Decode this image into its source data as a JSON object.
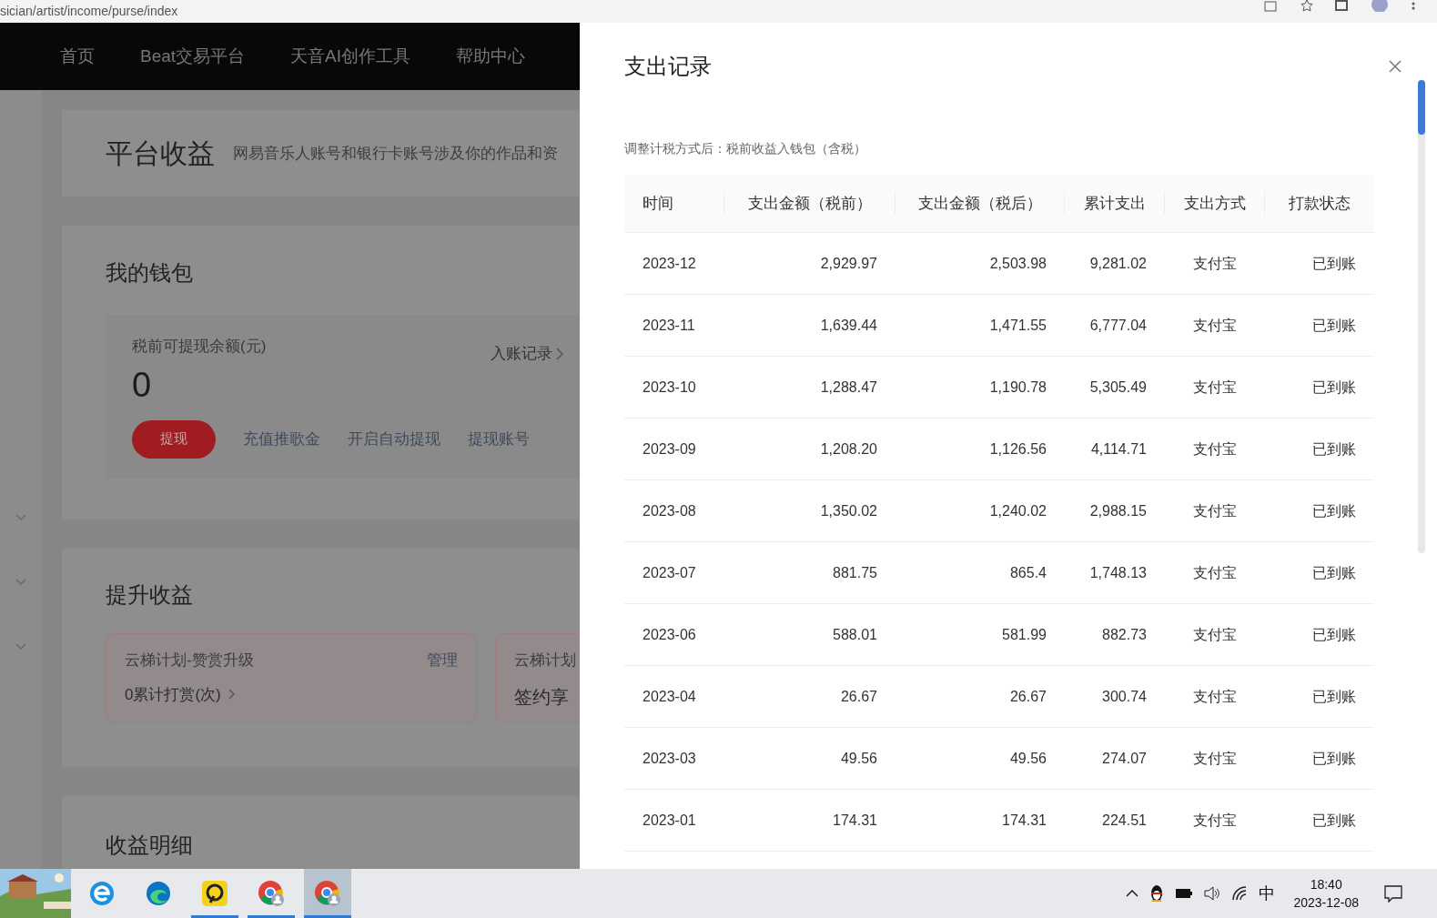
{
  "browser": {
    "url": "sician/artist/income/purse/index"
  },
  "nav": [
    {
      "label": "首页"
    },
    {
      "label": "Beat交易平台"
    },
    {
      "label": "天音AI创作工具"
    },
    {
      "label": "帮助中心"
    }
  ],
  "page": {
    "header": {
      "title": "平台收益",
      "description": "网易音乐人账号和银行卡账号涉及你的作品和资"
    },
    "wallet": {
      "title": "我的钱包",
      "balance_label": "税前可提现余额(元)",
      "balance": "0",
      "records_link": "入账记录",
      "withdraw_button": "提现",
      "links": [
        "充值推歌金",
        "开启自动提现",
        "提现账号"
      ]
    },
    "boost": {
      "title": "提升收益",
      "cards": [
        {
          "title": "云梯计划-赞赏升级",
          "action": "管理",
          "stat": "0累计打赏(次)"
        },
        {
          "title": "云梯计划",
          "stat": "签约享"
        }
      ]
    },
    "details": {
      "title": "收益明细"
    }
  },
  "drawer": {
    "title": "支出记录",
    "note": "调整计税方式后：税前收益入钱包（含税）",
    "columns": [
      "时间",
      "支出金额（税前）",
      "支出金额（税后）",
      "累计支出",
      "支出方式",
      "打款状态"
    ],
    "rows": [
      [
        "2023-12",
        "2,929.97",
        "2,503.98",
        "9,281.02",
        "支付宝",
        "已到账"
      ],
      [
        "2023-11",
        "1,639.44",
        "1,471.55",
        "6,777.04",
        "支付宝",
        "已到账"
      ],
      [
        "2023-10",
        "1,288.47",
        "1,190.78",
        "5,305.49",
        "支付宝",
        "已到账"
      ],
      [
        "2023-09",
        "1,208.20",
        "1,126.56",
        "4,114.71",
        "支付宝",
        "已到账"
      ],
      [
        "2023-08",
        "1,350.02",
        "1,240.02",
        "2,988.15",
        "支付宝",
        "已到账"
      ],
      [
        "2023-07",
        "881.75",
        "865.4",
        "1,748.13",
        "支付宝",
        "已到账"
      ],
      [
        "2023-06",
        "588.01",
        "581.99",
        "882.73",
        "支付宝",
        "已到账"
      ],
      [
        "2023-04",
        "26.67",
        "26.67",
        "300.74",
        "支付宝",
        "已到账"
      ],
      [
        "2023-03",
        "49.56",
        "49.56",
        "274.07",
        "支付宝",
        "已到账"
      ],
      [
        "2023-01",
        "174.31",
        "174.31",
        "224.51",
        "支付宝",
        "已到账"
      ]
    ]
  },
  "taskbar": {
    "apps": [
      {
        "kind": "ie",
        "running": false,
        "selected": false
      },
      {
        "kind": "edge",
        "running": false,
        "selected": false
      },
      {
        "kind": "app",
        "running": true,
        "selected": false
      },
      {
        "kind": "chrome",
        "running": true,
        "selected": false
      },
      {
        "kind": "chrome",
        "running": true,
        "selected": true
      }
    ],
    "ime": "中",
    "time": "18:40",
    "date": "2023-12-08"
  }
}
